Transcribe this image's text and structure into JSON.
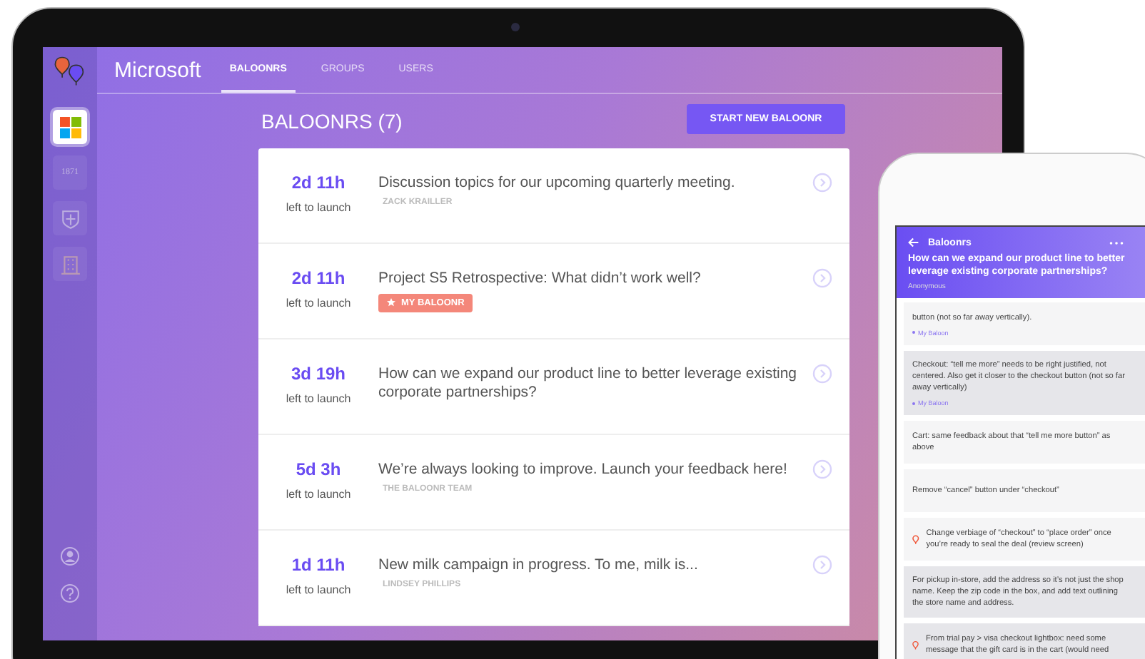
{
  "laptop": {
    "sidebar": {
      "items": [
        {
          "kind": "windows",
          "selected": true
        },
        {
          "kind": "text",
          "label": "1871",
          "selected": false
        },
        {
          "kind": "shield",
          "selected": false
        },
        {
          "kind": "building",
          "selected": false
        }
      ]
    },
    "header": {
      "org": "Microsoft",
      "tabs": [
        {
          "label": "BALOONRS",
          "selected": true
        },
        {
          "label": "GROUPS",
          "selected": false
        },
        {
          "label": "USERS",
          "selected": false
        }
      ]
    },
    "title": "BALOONRS (7)",
    "new_button": "START NEW BALOONR",
    "rows": [
      {
        "time": "2d 11h",
        "caption": "left to launch",
        "title": "Discussion topics for our upcoming quarterly meeting.",
        "author": "ZACK KRAILLER"
      },
      {
        "time": "2d 11h",
        "caption": "left to launch",
        "title": "Project S5 Retrospective: What didn’t work well?",
        "tag": "MY BALOONR"
      },
      {
        "time": "3d 19h",
        "caption": "left to launch",
        "title": "How can we expand our product line to better leverage existing corporate partnerships?"
      },
      {
        "time": "5d 3h",
        "caption": "left to launch",
        "title": "We’re always looking to improve. Launch your feedback here!",
        "author": "THE BALOONR TEAM"
      },
      {
        "time": "1d 11h",
        "caption": "left to launch",
        "title": "New milk campaign in progress. To me, milk is...",
        "author": "LINDSEY PHILLIPS"
      }
    ]
  },
  "phone": {
    "header": {
      "back": "Baloonrs",
      "question": "How can we expand our product line to better leverage existing corporate partnerships?",
      "author": "Anonymous"
    },
    "cards": [
      {
        "text": "button (not so far away vertically).",
        "tag": "My Baloon",
        "highlighted": false,
        "launched": false
      },
      {
        "text": "Checkout: “tell me more” needs to be right justified, not centered. Also get it closer to the checkout button (not so far away vertically)",
        "tag": "My Baloon",
        "highlighted": true,
        "launched": false
      },
      {
        "text": "Cart: same feedback about that “tell me more button” as above",
        "highlighted": false,
        "launched": false
      },
      {
        "text": "Remove “cancel” button under “checkout”",
        "highlighted": false,
        "launched": false
      },
      {
        "text": "Change verbiage of “checkout” to “place order” once you’re ready to seal the deal (review screen)",
        "highlighted": false,
        "launched": true
      },
      {
        "text": "For pickup in-store, add the address so it’s not just the shop name. Keep the zip code in the box, and add text outlining the store name and address.",
        "highlighted": true,
        "launched": false
      },
      {
        "text": "From trial pay > visa checkout lightbox: need some message that the gift card is in the cart (would need",
        "highlighted": true,
        "launched": true
      }
    ]
  }
}
